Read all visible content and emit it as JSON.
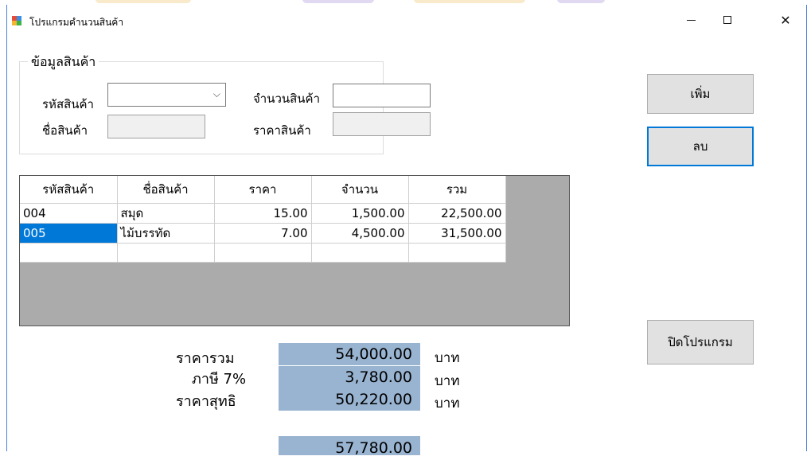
{
  "window": {
    "title": "โปรแกรมคำนวนสินค้า",
    "controls": {
      "minimize": "—",
      "maximize": "☐",
      "close": "✕"
    }
  },
  "product_group": {
    "title": "ข้อมูลสินค้า",
    "code_label": "รหัสสินค้า",
    "code_value": "",
    "name_label": "ชื่อสินค้า",
    "name_value": "",
    "qty_label": "จำนวนสินค้า",
    "qty_value": "",
    "price_label": "ราคาสินค้า",
    "price_value": ""
  },
  "buttons": {
    "add": "เพิ่ม",
    "delete": "ลบ",
    "close_program": "ปิดโปรแกรม"
  },
  "grid": {
    "columns": [
      "รหัสสินค้า",
      "ชื่อสินค้า",
      "ราคา",
      "จำนวน",
      "รวม"
    ],
    "rows": [
      [
        "004",
        "สมุด",
        "15.00",
        "1,500.00",
        "22,500.00"
      ],
      [
        "005",
        "ไม้บรรทัด",
        "7.00",
        "4,500.00",
        "31,500.00"
      ],
      [
        "",
        "",
        "",
        "",
        ""
      ]
    ]
  },
  "summary": {
    "total_label": "ราคารวม",
    "total_value": "54,000.00",
    "vat_label": "ภาษี 7%",
    "vat_value": "3,780.00",
    "net_label": "ราคาสุทธิ",
    "net_value": "50,220.00",
    "unit": "บาท",
    "extra_value": "57,780.00"
  },
  "colors": {
    "selection": "#0078d7",
    "summary_bg": "#99b4d1",
    "grid_bg": "#ababab"
  }
}
